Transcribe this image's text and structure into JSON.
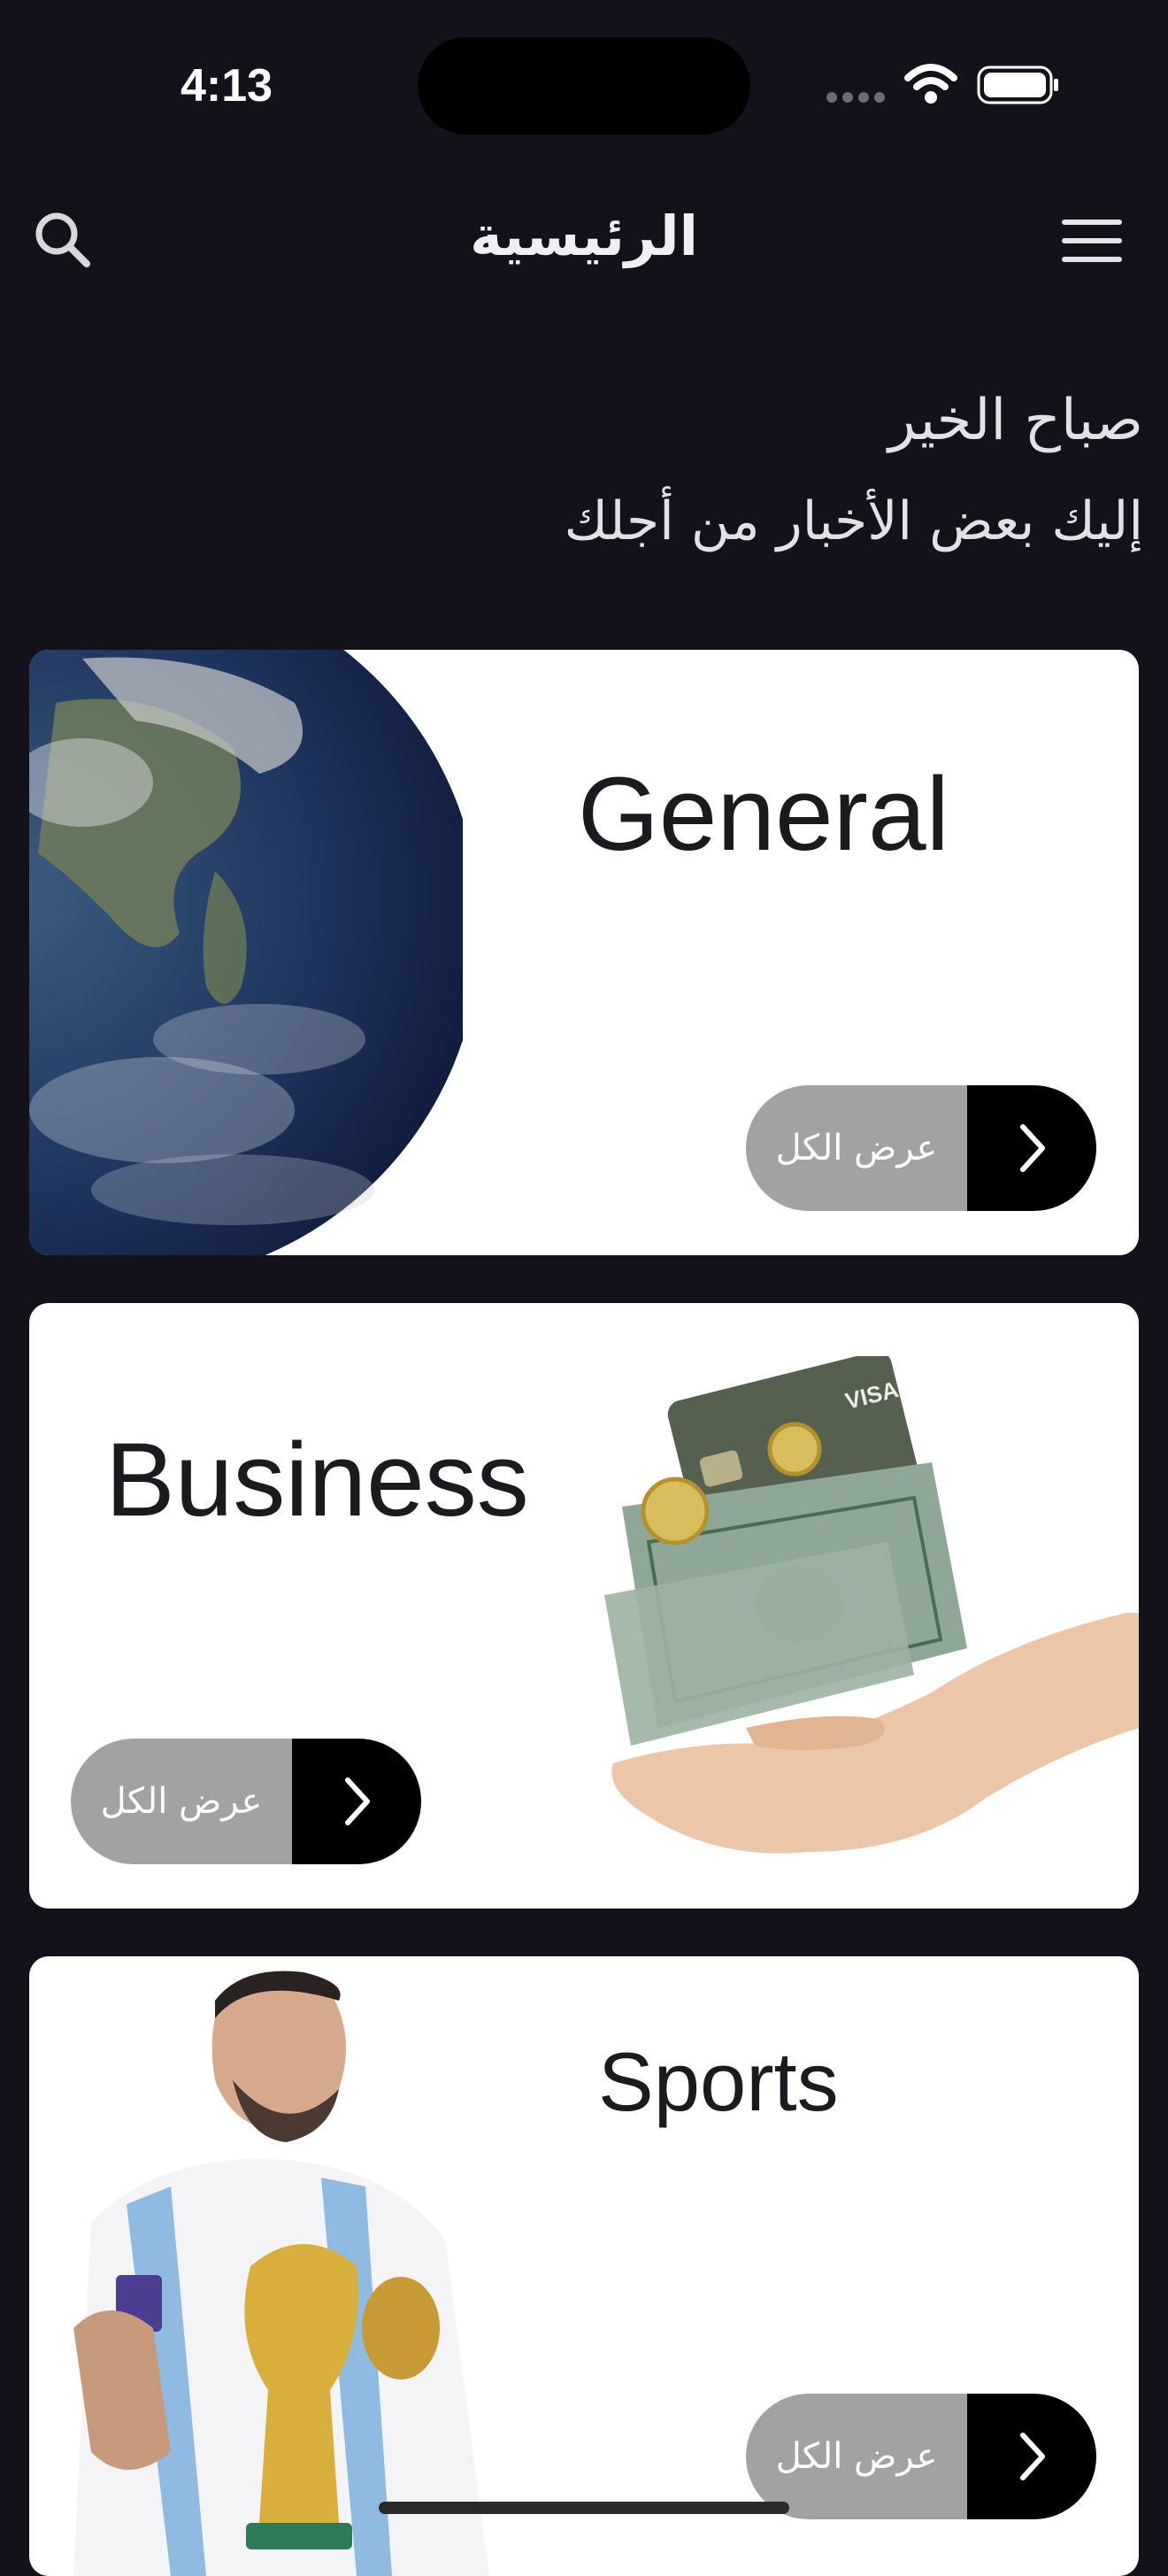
{
  "status_bar": {
    "time": "4:13"
  },
  "nav": {
    "title": "الرئيسية"
  },
  "greeting": {
    "line1": "صباح الخير",
    "line2": "إليك بعض الأخبار من أجلك"
  },
  "cards": [
    {
      "title": "General",
      "button_label": "عرض الكل",
      "image": "earth-image"
    },
    {
      "title": "Business",
      "button_label": "عرض الكل",
      "image": "money-hand-image"
    },
    {
      "title": "Sports",
      "button_label": "عرض الكل",
      "image": "footballer-trophy-image"
    }
  ],
  "icons": {
    "search": "search-icon",
    "menu": "menu-icon",
    "chevron": "chevron-right-icon"
  },
  "colors": {
    "background": "#13111a",
    "card": "#ffffff",
    "button_label_bg": "#a2a2a2",
    "button_arrow_bg": "#000000"
  }
}
